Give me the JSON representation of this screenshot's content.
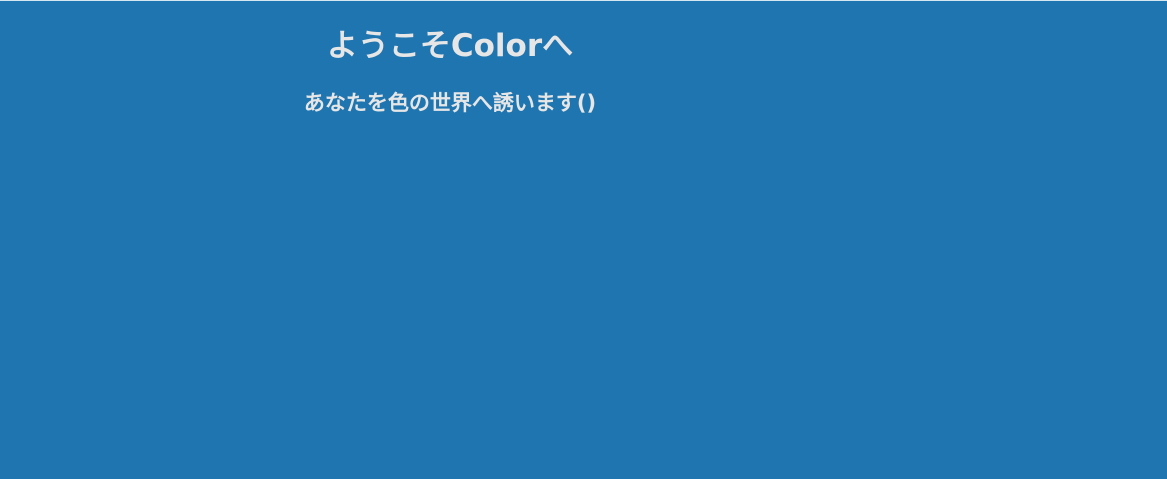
{
  "page": {
    "background_color": "#1f75af",
    "text_color": "#e6e6e6"
  },
  "hero": {
    "title": "ようこそColorへ",
    "subtitle": "あなたを色の世界へ誘います()"
  }
}
